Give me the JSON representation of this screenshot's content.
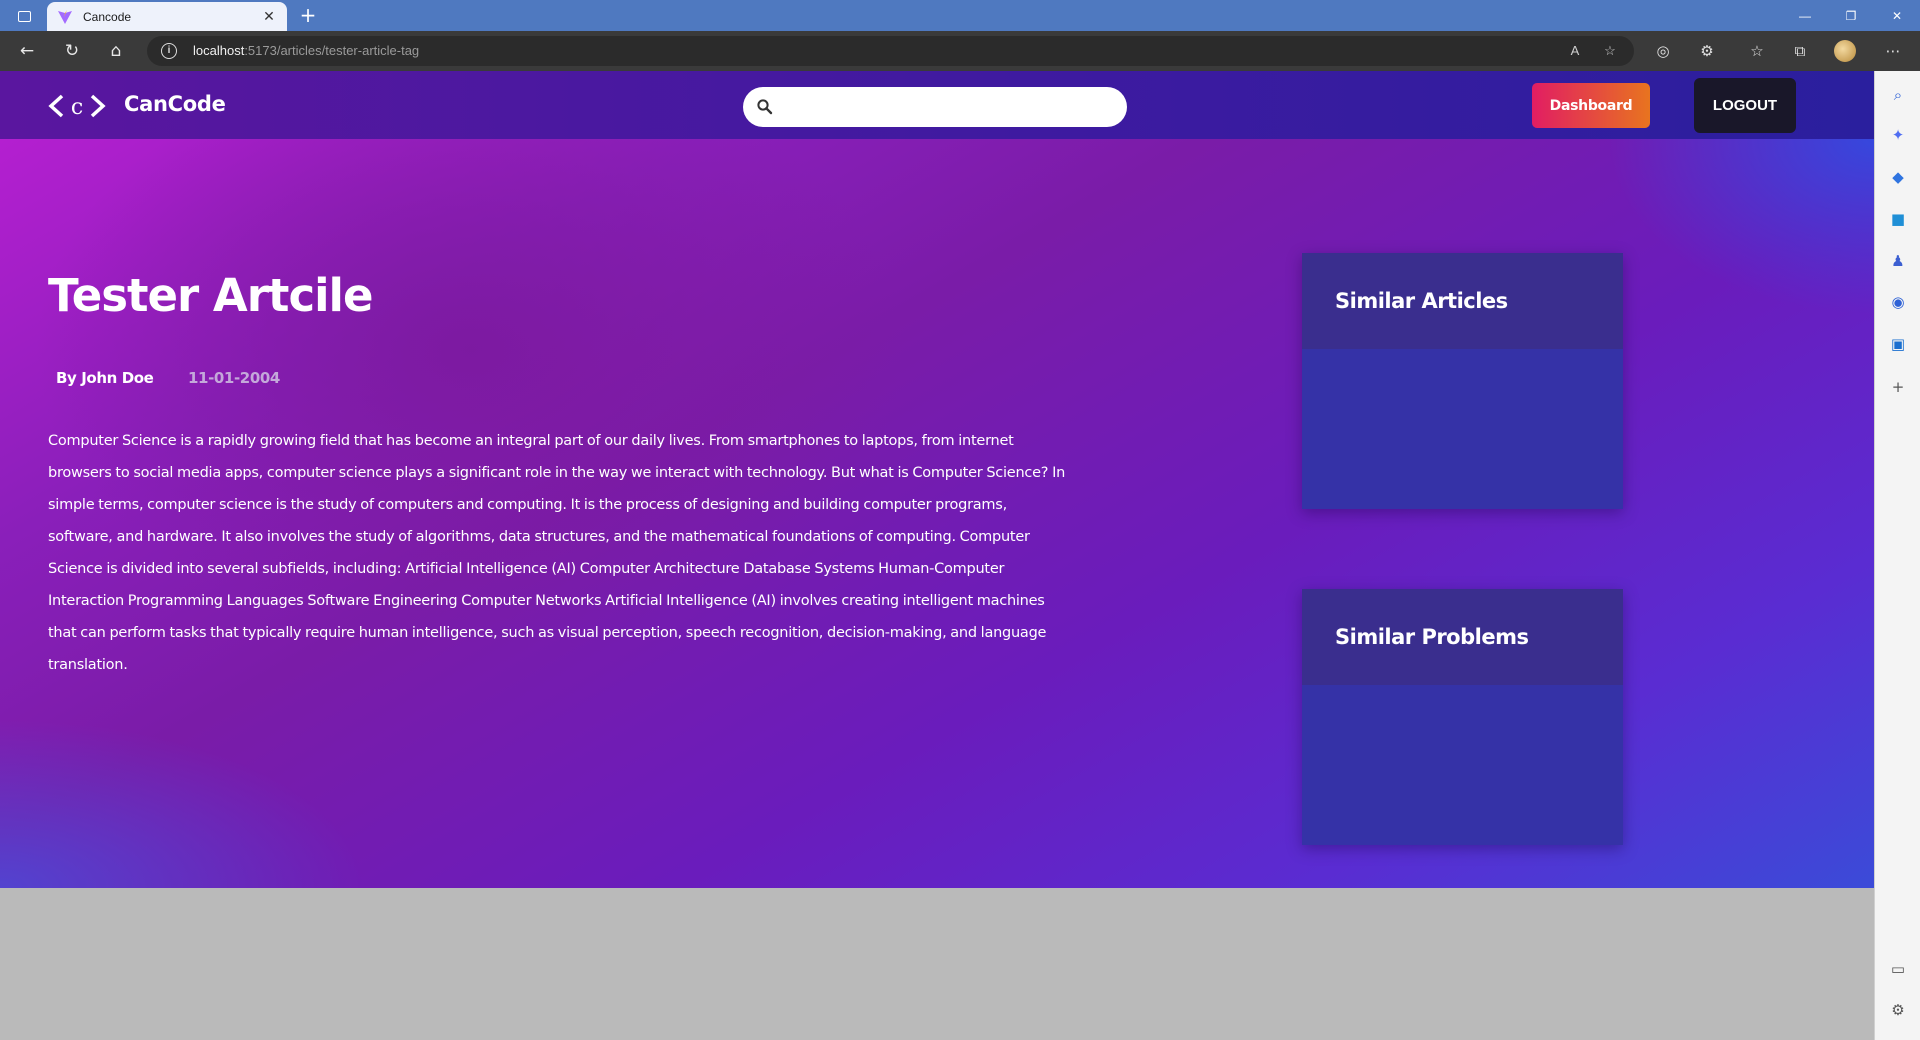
{
  "browser": {
    "tab_title": "Cancode",
    "url_host": "localhost",
    "url_path": ":5173/articles/tester-article-tag",
    "new_tab_symbol": "+",
    "close_symbol": "✕"
  },
  "navbar": {
    "logo_text": "<c>",
    "brand": "CanCode",
    "search_placeholder": "",
    "dashboard_label": "Dashboard",
    "logout_label": "LOGOUT"
  },
  "article": {
    "title": "Tester Artcile",
    "author": "By John Doe",
    "date": "11-01-2004",
    "body": "Computer Science is a rapidly growing field that has become an integral part of our daily lives. From smartphones to laptops, from internet browsers to social media apps, computer science plays a significant role in the way we interact with technology. But what is Computer Science? In simple terms, computer science is the study of computers and computing. It is the process of designing and building computer programs, software, and hardware. It also involves the study of algorithms, data structures, and the mathematical foundations of computing. Computer Science is divided into several subfields, including: Artificial Intelligence (AI) Computer Architecture Database Systems Human-Computer Interaction Programming Languages Software Engineering Computer Networks Artificial Intelligence (AI) involves creating intelligent machines that can perform tasks that typically require human intelligence, such as visual perception, speech recognition, decision-making, and language translation."
  },
  "sidebar": {
    "similar_articles_title": "Similar Articles",
    "similar_problems_title": "Similar Problems"
  },
  "colors": {
    "navbar": "#4a18a0",
    "dashboard_gradient_start": "#e11d63",
    "dashboard_gradient_end": "#e8741f",
    "logout_bg": "#191729",
    "card_bg": "#3532a7",
    "card_header_bg": "#3a2e8e"
  }
}
